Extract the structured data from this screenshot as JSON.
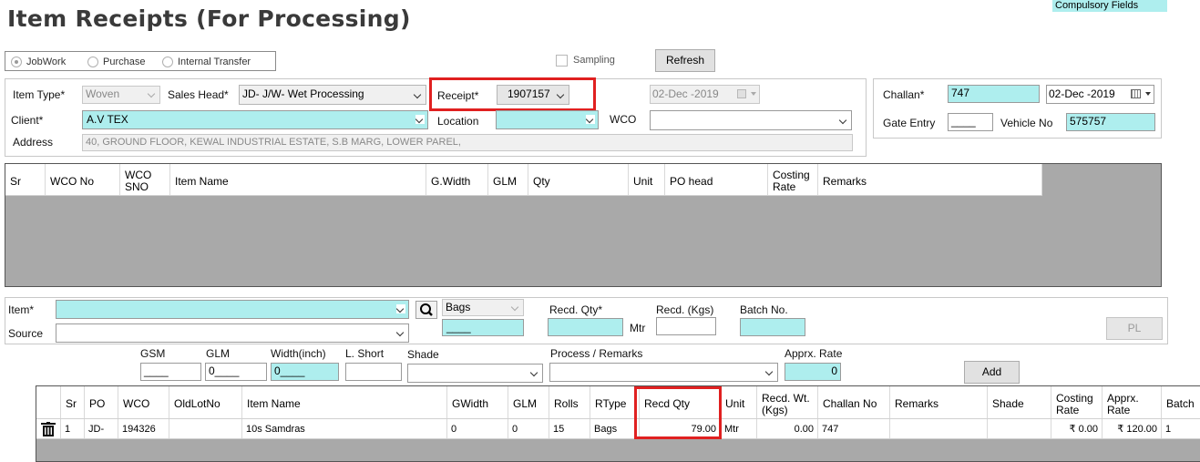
{
  "title": "Item Receipts (For Processing)",
  "compulsory_label": "Compulsory Fields",
  "receipt_type": {
    "options": [
      "JobWork",
      "Purchase",
      "Internal Transfer"
    ],
    "selected": "JobWork"
  },
  "sampling_label": "Sampling",
  "refresh_label": "Refresh",
  "header": {
    "item_type_label": "Item Type*",
    "item_type_value": "Woven",
    "sales_head_label": "Sales Head*",
    "sales_head_value": "JD- J/W- Wet Processing",
    "receipt_label": "Receipt*",
    "receipt_value": "1907157",
    "receipt_date": "02-Dec -2019",
    "client_label": "Client*",
    "client_value": "A.V TEX",
    "location_label": "Location",
    "location_value": "",
    "wco_label": "WCO",
    "wco_value": "",
    "address_label": "Address",
    "address_value": "40, GROUND FLOOR, KEWAL INDUSTRIAL ESTATE, S.B MARG, LOWER PAREL,",
    "challan_label": "Challan*",
    "challan_value": "747",
    "challan_date": "02-Dec -2019",
    "gate_entry_label": "Gate Entry",
    "gate_entry_value": "____",
    "vehicle_label": "Vehicle No",
    "vehicle_value": "575757"
  },
  "wco_grid": {
    "columns": [
      "Sr",
      "WCO No",
      "WCO SNO",
      "Item Name",
      "G.Width",
      "GLM",
      "Qty",
      "Unit",
      "PO head",
      "Costing Rate",
      "Remarks"
    ]
  },
  "item_entry": {
    "item_label": "Item*",
    "item_value": "",
    "source_label": "Source",
    "source_value": "",
    "unit_value": "Bags",
    "bags_qty_value": "____",
    "recd_qty_label": "Recd. Qty*",
    "recd_qty_value": "",
    "mtr_label": "Mtr",
    "recd_kgs_label": "Recd. (Kgs)",
    "recd_kgs_value": "",
    "batch_label": "Batch No.",
    "batch_value": "",
    "pl_label": "PL",
    "gsm_label": "GSM",
    "gsm_value": "____",
    "glm_label": "GLM",
    "glm_value": "0____",
    "width_label": "Width(inch)",
    "width_value": "0____",
    "lshort_label": "L. Short",
    "lshort_value": "",
    "shade_label": "Shade",
    "shade_value": "",
    "process_label": "Process / Remarks",
    "process_value": "",
    "rate_label": "Apprx. Rate",
    "rate_value": "0",
    "add_label": "Add"
  },
  "items_grid": {
    "columns": [
      "Sr",
      "PO",
      "WCO",
      "OldLotNo",
      "Item Name",
      "GWidth",
      "GLM",
      "Rolls",
      "RType",
      "Recd Qty",
      "Unit",
      "Recd. Wt.(Kgs)",
      "Challan No",
      "Remarks",
      "Shade",
      "Costing Rate",
      "Apprx. Rate",
      "Batch"
    ],
    "rows": [
      {
        "sr": "1",
        "po": "JD-",
        "wco": "194326",
        "oldlot": "",
        "item_name": "10s  Samdras",
        "gwidth": "0",
        "glm": "0",
        "rolls": "15",
        "rtype": "Bags",
        "recd_qty": "79.00",
        "unit": "Mtr",
        "recd_wt": "0.00",
        "challan_no": "747",
        "remarks": "",
        "shade": "",
        "costing_rate": "₹ 0.00",
        "apprx_rate": "₹ 120.00",
        "batch": "1"
      }
    ]
  },
  "colors": {
    "compulsory": "#aeeeee",
    "highlight": "#e02020",
    "grid_empty": "#a9a9a9"
  }
}
